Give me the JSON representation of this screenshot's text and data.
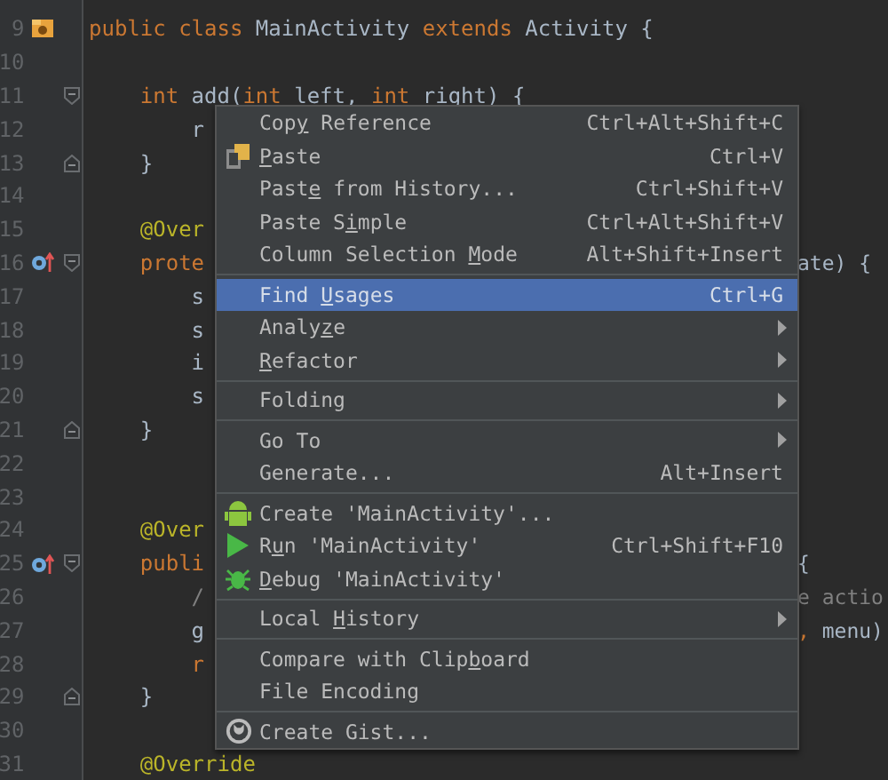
{
  "editor": {
    "lines": [
      {
        "number": "9",
        "kind": "class-declaration",
        "tokens": [
          {
            "kind": "keyword",
            "text": "public class "
          },
          {
            "kind": "plain",
            "text": "MainActivity "
          },
          {
            "kind": "keyword",
            "text": "extends "
          },
          {
            "kind": "plain",
            "text": "Activity {"
          }
        ]
      },
      {
        "number": "10",
        "kind": "code"
      },
      {
        "number": "11",
        "kind": "fold-start",
        "tokens": [
          {
            "kind": "keyword",
            "text": "    int "
          },
          {
            "kind": "plain",
            "text": "add("
          },
          {
            "kind": "keyword",
            "text": "int "
          },
          {
            "kind": "plain",
            "text": "left, "
          },
          {
            "kind": "keyword",
            "text": "int "
          },
          {
            "kind": "plain",
            "text": "right) {"
          }
        ]
      },
      {
        "number": "12",
        "kind": "code",
        "tokens": [
          {
            "kind": "plain",
            "text": "        r"
          }
        ]
      },
      {
        "number": "13",
        "kind": "fold-end",
        "tokens": [
          {
            "kind": "plain",
            "text": "    }"
          }
        ]
      },
      {
        "number": "14",
        "kind": "code"
      },
      {
        "number": "15",
        "kind": "code",
        "tokens": [
          {
            "kind": "annotation",
            "text": "    @Over"
          }
        ]
      },
      {
        "number": "16",
        "kind": "override-method",
        "tokens": [
          {
            "kind": "keyword",
            "text": "    prote"
          }
        ],
        "right": [
          {
            "kind": "plain",
            "text": "ate) {"
          }
        ]
      },
      {
        "number": "17",
        "kind": "code",
        "tokens": [
          {
            "kind": "plain",
            "text": "        s"
          }
        ]
      },
      {
        "number": "18",
        "kind": "code",
        "tokens": [
          {
            "kind": "plain",
            "text": "        s"
          }
        ]
      },
      {
        "number": "19",
        "kind": "code",
        "tokens": [
          {
            "kind": "plain",
            "text": "        i"
          }
        ]
      },
      {
        "number": "20",
        "kind": "code",
        "tokens": [
          {
            "kind": "plain",
            "text": "        s"
          }
        ]
      },
      {
        "number": "21",
        "kind": "fold-end",
        "tokens": [
          {
            "kind": "plain",
            "text": "    }"
          }
        ]
      },
      {
        "number": "22",
        "kind": "code"
      },
      {
        "number": "23",
        "kind": "code"
      },
      {
        "number": "24",
        "kind": "code",
        "tokens": [
          {
            "kind": "annotation",
            "text": "    @Over"
          }
        ]
      },
      {
        "number": "25",
        "kind": "override-method",
        "tokens": [
          {
            "kind": "keyword",
            "text": "    publi"
          }
        ],
        "right": [
          {
            "kind": "plain",
            "text": "{"
          }
        ]
      },
      {
        "number": "26",
        "kind": "code",
        "tokens": [
          {
            "kind": "comment",
            "text": "        /"
          }
        ],
        "right": [
          {
            "kind": "comment",
            "text": "e actio"
          }
        ]
      },
      {
        "number": "27",
        "kind": "code",
        "tokens": [
          {
            "kind": "plain",
            "text": "        g"
          }
        ],
        "right": [
          {
            "kind": "keyword",
            "text": ","
          },
          {
            "kind": "plain",
            "text": " menu)"
          }
        ]
      },
      {
        "number": "28",
        "kind": "code",
        "tokens": [
          {
            "kind": "keyword",
            "text": "        r"
          }
        ]
      },
      {
        "number": "29",
        "kind": "fold-end",
        "tokens": [
          {
            "kind": "plain",
            "text": "    }"
          }
        ]
      },
      {
        "number": "30",
        "kind": "code"
      },
      {
        "number": "31",
        "kind": "code",
        "tokens": [
          {
            "kind": "annotation",
            "text": "    @Override"
          }
        ]
      }
    ]
  },
  "context_menu": {
    "groups": [
      [
        {
          "kind": "plain",
          "pre": "Cop",
          "key": "y",
          "post": " Reference",
          "shortcut": "Ctrl+Alt+Shift+C",
          "selected": false,
          "submenu": false
        },
        {
          "kind": "paste",
          "key": "P",
          "post": "aste",
          "shortcut": "Ctrl+V",
          "selected": false,
          "submenu": false
        },
        {
          "kind": "plain",
          "pre": "Past",
          "key": "e",
          "post": " from History...",
          "shortcut": "Ctrl+Shift+V",
          "selected": false,
          "submenu": false
        },
        {
          "kind": "plain",
          "pre": "Paste S",
          "key": "i",
          "post": "mple",
          "shortcut": "Ctrl+Alt+Shift+V",
          "selected": false,
          "submenu": false
        },
        {
          "kind": "plain",
          "pre": "Column Selection ",
          "key": "M",
          "post": "ode",
          "shortcut": "Alt+Shift+Insert",
          "selected": false,
          "submenu": false
        }
      ],
      [
        {
          "kind": "plain",
          "pre": "Find ",
          "key": "U",
          "post": "sages",
          "shortcut": "Ctrl+G",
          "selected": true,
          "submenu": false
        },
        {
          "kind": "plain",
          "pre": "Analy",
          "key": "z",
          "post": "e",
          "selected": false,
          "submenu": true
        },
        {
          "kind": "plain",
          "key": "R",
          "post": "efactor",
          "selected": false,
          "submenu": true
        }
      ],
      [
        {
          "kind": "plain",
          "pre": "Folding",
          "selected": false,
          "submenu": true
        }
      ],
      [
        {
          "kind": "plain",
          "pre": "Go To",
          "selected": false,
          "submenu": true
        },
        {
          "kind": "plain",
          "pre": "Generate...",
          "shortcut": "Alt+Insert",
          "selected": false,
          "submenu": false
        }
      ],
      [
        {
          "kind": "create",
          "pre": "Create 'MainActivity'...",
          "selected": false,
          "submenu": false
        },
        {
          "kind": "run",
          "pre": "R",
          "key": "u",
          "post": "n 'MainActivity'",
          "shortcut": "Ctrl+Shift+F10",
          "selected": false,
          "submenu": false
        },
        {
          "kind": "debug",
          "key": "D",
          "post": "ebug 'MainActivity'",
          "selected": false,
          "submenu": false
        }
      ],
      [
        {
          "kind": "plain",
          "pre": "Local ",
          "key": "H",
          "post": "istory",
          "selected": false,
          "submenu": true
        }
      ],
      [
        {
          "kind": "plain",
          "pre": "Compare with Clip",
          "key": "b",
          "post": "oard",
          "selected": false,
          "submenu": false
        },
        {
          "kind": "plain",
          "pre": "File Encoding",
          "selected": false,
          "submenu": false
        }
      ],
      [
        {
          "kind": "gist",
          "pre": "Create Gist...",
          "selected": false,
          "submenu": false
        }
      ]
    ]
  }
}
